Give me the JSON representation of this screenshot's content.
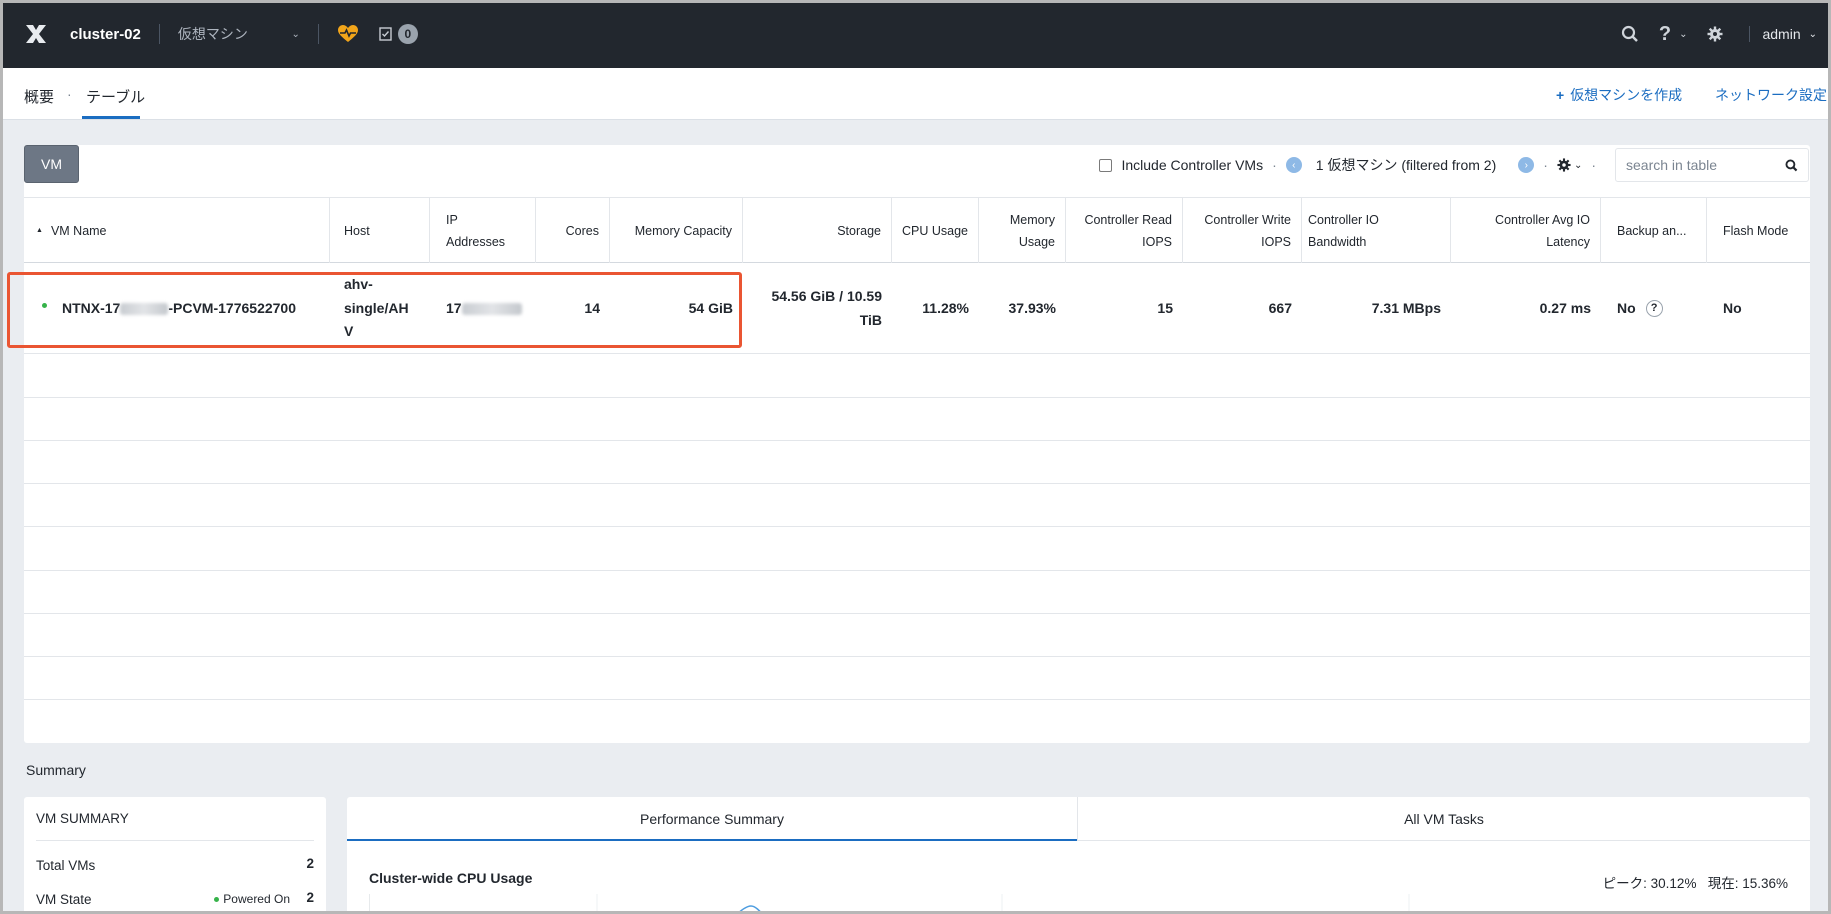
{
  "topbar": {
    "cluster_name": "cluster-02",
    "menu_label": "仮想マシン",
    "task_count": "0",
    "user": "admin"
  },
  "subnav": {
    "tab_overview": "概要",
    "tab_table": "テーブル",
    "create_vm": "仮想マシンを作成",
    "network_settings": "ネットワーク設定"
  },
  "toolbar": {
    "vm_button": "VM",
    "include_controller": "Include Controller VMs",
    "count_text": "1 仮想マシン (filtered from 2)",
    "search_placeholder": "search in table"
  },
  "table": {
    "headers": {
      "vm_name": "VM Name",
      "host": "Host",
      "ip_line1": "IP",
      "ip_line2": "Addresses",
      "cores": "Cores",
      "memory_capacity": "Memory Capacity",
      "storage": "Storage",
      "cpu_usage": "CPU Usage",
      "mem_usage_line1": "Memory",
      "mem_usage_line2": "Usage",
      "ctrl_read_line1": "Controller Read",
      "ctrl_read_line2": "IOPS",
      "ctrl_write_line1": "Controller Write",
      "ctrl_write_line2": "IOPS",
      "ctrl_bw": "Controller IO Bandwidth",
      "ctrl_lat_line1": "Controller Avg IO",
      "ctrl_lat_line2": "Latency",
      "backup": "Backup an...",
      "flash": "Flash Mode"
    },
    "row": {
      "vm_name_prefix": "NTNX-17",
      "vm_name_suffix": "-PCVM-1776522700",
      "host_line1": "ahv-",
      "host_line2": "single/AH",
      "host_line3": "V",
      "ip_prefix": "17",
      "cores": "14",
      "memory_capacity": "54 GiB",
      "storage_line1": "54.56 GiB / 10.59",
      "storage_line2": "TiB",
      "cpu_usage": "11.28%",
      "memory_usage": "37.93%",
      "ctrl_read": "15",
      "ctrl_write": "667",
      "ctrl_bw": "7.31 MBps",
      "ctrl_lat": "0.27 ms",
      "backup": "No",
      "flash": "No"
    }
  },
  "summary": {
    "title": "Summary",
    "vm_summary_title": "VM SUMMARY",
    "total_vms_label": "Total VMs",
    "total_vms_value": "2",
    "vm_state_label": "VM State",
    "powered_on_label": "Powered On",
    "powered_on_value": "2",
    "tab_performance": "Performance Summary",
    "tab_tasks": "All VM Tasks",
    "cpu_title": "Cluster-wide CPU Usage",
    "cpu_stats": "ピーク: 30.12%   現在: 15.36%"
  },
  "colors": {
    "topbar": "#22272e",
    "accent": "#1b6dc1",
    "highlight": "#ea5532",
    "status_green": "#36b34a"
  }
}
